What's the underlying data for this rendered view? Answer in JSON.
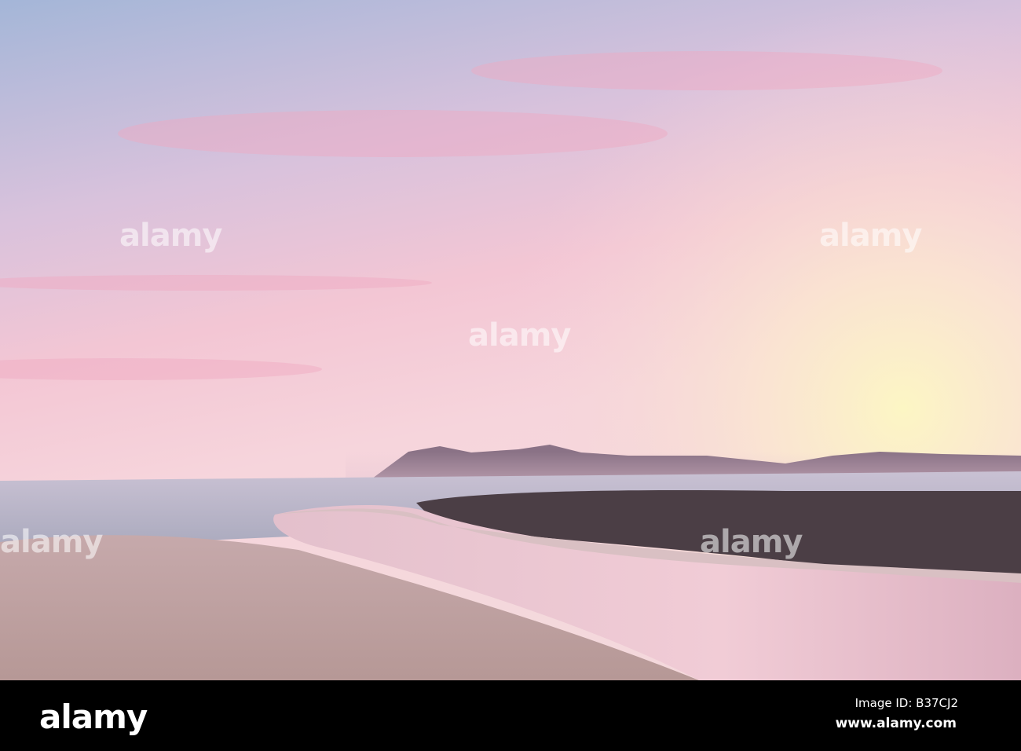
{
  "watermark": {
    "text": "alamy"
  },
  "footer": {
    "logo": "alamy",
    "image_id": "Image ID: B37CJ2",
    "website": "www.alamy.com"
  },
  "colors": {
    "sky_top": "#a8b9da",
    "sky_pink": "#f2c3d3",
    "sky_glow": "#fbf0c0",
    "hills": "#6f5a6c",
    "vegetation": "#4a3d44",
    "sand": "#c8a8a6",
    "river": "#ebc3cf",
    "sea": "#b7b3c6"
  }
}
